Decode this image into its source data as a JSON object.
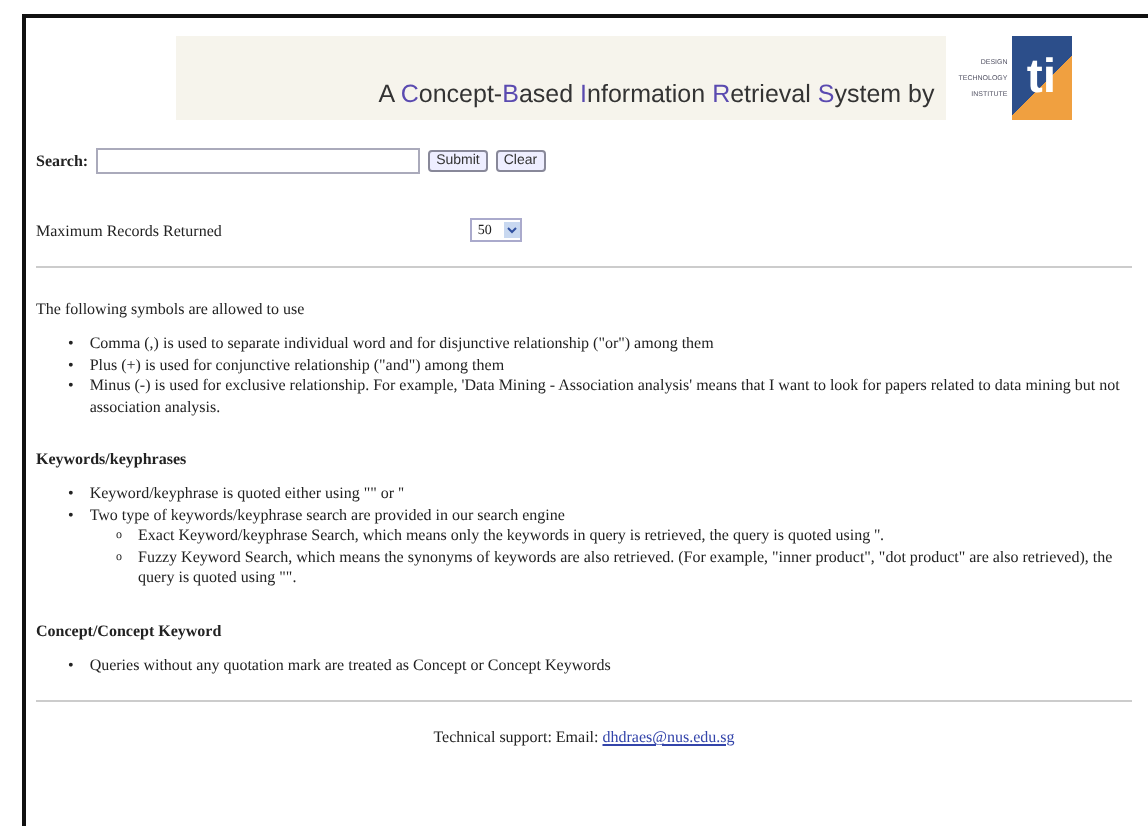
{
  "banner": {
    "title_parts": [
      {
        "text": "A ",
        "highlight": false
      },
      {
        "text": "C",
        "highlight": true
      },
      {
        "text": "oncept-",
        "highlight": false
      },
      {
        "text": "B",
        "highlight": true
      },
      {
        "text": "ased ",
        "highlight": false
      },
      {
        "text": "I",
        "highlight": true
      },
      {
        "text": "nformation ",
        "highlight": false
      },
      {
        "text": "R",
        "highlight": true
      },
      {
        "text": "etrieval ",
        "highlight": false
      },
      {
        "text": "S",
        "highlight": true
      },
      {
        "text": "ystem by",
        "highlight": false
      }
    ],
    "logo": {
      "lines": [
        "DESIGN",
        "TECHNOLOGY",
        "INSTITUTE"
      ],
      "mark": "ti"
    }
  },
  "search": {
    "label": "Search:",
    "buttons": [
      "Submit",
      "Clear"
    ]
  },
  "max_records": {
    "label": "Maximum Records Returned",
    "value": "50"
  },
  "intro": "The following symbols are allowed to use",
  "sections": [
    {
      "items": [
        {
          "marker": "•",
          "text": "Comma (,) is used to separate individual word and for disjunctive relationship (\"or\") among them"
        },
        {
          "marker": "•",
          "text": "Plus (+) is used for conjunctive relationship (\"and\") among them"
        },
        {
          "marker": "•",
          "text": "Minus (-) is used for exclusive relationship. For example, 'Data Mining - Association analysis' means that I want to look for papers related to data mining but not association analysis."
        }
      ]
    },
    {
      "heading": "Keywords/keyphrases",
      "items": [
        {
          "marker": "•",
          "text": "Keyword/keyphrase is quoted either using \"\" or ''"
        },
        {
          "marker": "•",
          "text": "Two type of keywords/keyphrase search are provided in our search engine",
          "children": [
            {
              "marker": "o",
              "text": "Exact Keyword/keyphrase Search, which means only the keywords in query is retrieved, the query is quoted using ''."
            },
            {
              "marker": "o",
              "text": "Fuzzy Keyword Search, which means the synonyms of keywords are also retrieved. (For example, \"inner product\", \"dot product\" are also retrieved), the query is quoted using \"\"."
            }
          ]
        }
      ]
    },
    {
      "heading": "Concept/Concept Keyword",
      "items": [
        {
          "marker": "•",
          "text": "Queries without any quotation mark are treated as Concept or Concept Keywords"
        }
      ]
    }
  ],
  "footer": {
    "label": "Technical support: Email:",
    "email": "dhdraes@nus.edu.sg"
  }
}
